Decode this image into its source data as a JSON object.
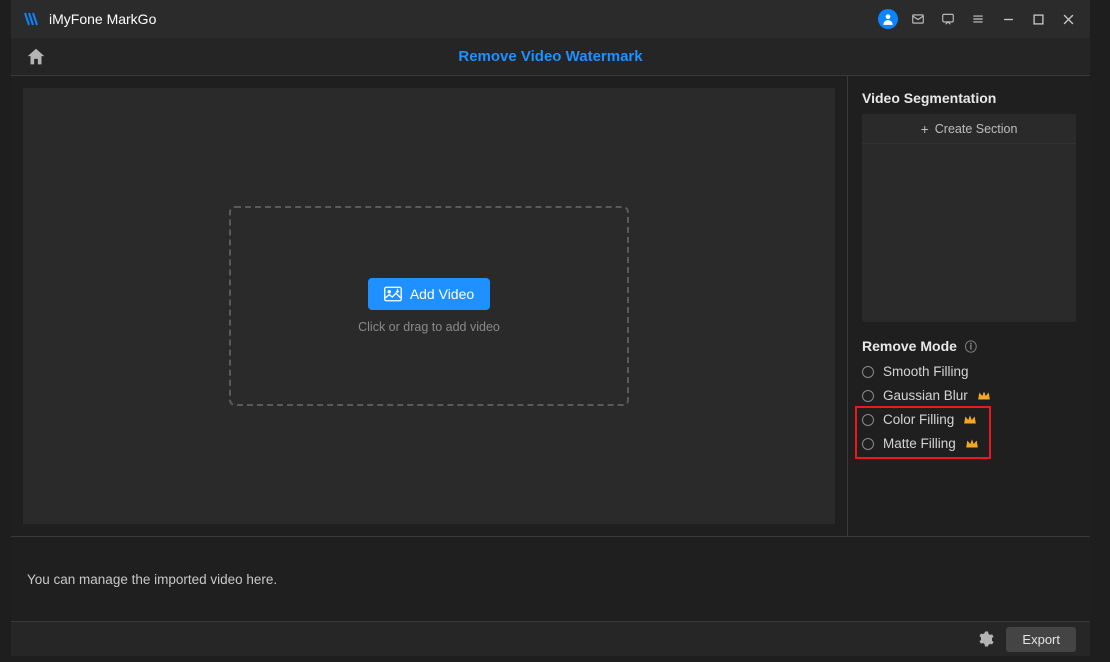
{
  "app": {
    "title": "iMyFone MarkGo"
  },
  "topnav": {
    "title": "Remove Video Watermark"
  },
  "dropzone": {
    "button": "Add Video",
    "hint": "Click or drag to add video"
  },
  "sidebar": {
    "seg_heading": "Video Segmentation",
    "create_section": "Create Section",
    "mode_heading": "Remove Mode",
    "modes": [
      {
        "label": "Smooth Filling",
        "premium": false
      },
      {
        "label": "Gaussian Blur",
        "premium": true
      },
      {
        "label": "Color Filling",
        "premium": true
      },
      {
        "label": "Matte Filling",
        "premium": true
      }
    ]
  },
  "hint": "You can manage the imported video here.",
  "footer": {
    "export": "Export"
  },
  "colors": {
    "accent": "#1e90ff",
    "highlight": "#ea1a1a",
    "premium": "#f5a623"
  }
}
